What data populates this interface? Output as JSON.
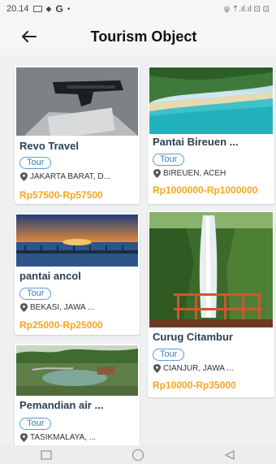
{
  "status_bar": {
    "time": "20.14",
    "g_label": "G",
    "dot": "•",
    "right_text": "ψ ⇡.ıl.ıl ⊡ ⊡"
  },
  "header": {
    "title": "Tourism Object",
    "back_icon": "arrow-left-icon"
  },
  "items": [
    {
      "title": "Revo Travel",
      "chip": "Tour",
      "location": "JAKARTA BARAT, D...",
      "price": "Rp57500-Rp57500"
    },
    {
      "title": "Pantai Bireuen ...",
      "chip": "Tour",
      "location": "BIREUEN, ACEH",
      "price": "Rp1000000-Rp1000000"
    },
    {
      "title": "pantai ancol",
      "chip": "Tour",
      "location": "BEKASI, JAWA ...",
      "price": "Rp25000-Rp25000"
    },
    {
      "title": "Curug Citambur",
      "chip": "Tour",
      "location": "CIANJUR, JAWA ...",
      "price": "Rp10000-Rp35000"
    },
    {
      "title": "Pemandian air ...",
      "chip": "Tour",
      "location": "TASIKMALAYA, ...",
      "price": ""
    }
  ],
  "nav": {
    "recents_icon": "square-icon",
    "home_icon": "circle-icon",
    "back_icon": "triangle-back-icon"
  },
  "colors": {
    "accent_chip": "#5a9bd8",
    "price": "#f5a623",
    "title": "#2b4050"
  }
}
